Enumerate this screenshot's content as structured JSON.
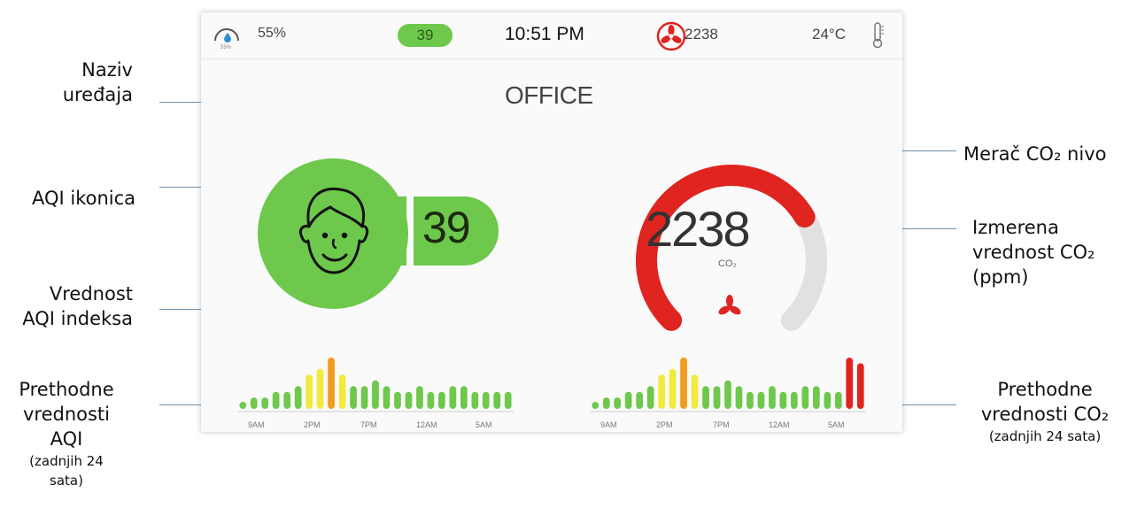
{
  "callouts": {
    "device_name": [
      "Naziv",
      "uređaja"
    ],
    "aqi_icon": "AQI ikonica",
    "aqi_value": [
      "Vrednost",
      "AQI indeksa"
    ],
    "aqi_history": [
      "Prethodne",
      "vrednosti",
      "AQI"
    ],
    "aqi_history_note": [
      "(zadnjih 24",
      "sata)"
    ],
    "co2_meter": "Merač CO₂ nivo",
    "co2_measured": [
      "Izmerena",
      "vrednost CO₂",
      "(ppm)"
    ],
    "co2_history": [
      "Prethodne",
      "vrednosti CO₂"
    ],
    "co2_history_note": "(zadnjih 24 sata)"
  },
  "status_bar": {
    "humidity": "55%",
    "gauge_caption": "55%",
    "aqi": "39",
    "time": "10:51 PM",
    "co2": "2238",
    "temperature": "24°C"
  },
  "device_name": "OFFICE",
  "aqi": {
    "value": "39",
    "level": 0.2
  },
  "co2": {
    "value": "2238",
    "unit": "CO₂",
    "gauge_fraction": 0.72
  },
  "history_ticks": [
    "9AM",
    "2PM",
    "7PM",
    "12AM",
    "5AM"
  ],
  "colors": {
    "green": "#6dc84b",
    "yellow": "#f2ea3c",
    "orange": "#f39a1f",
    "red": "#e0241f",
    "gray": "#e1e1e1"
  },
  "chart_data": [
    {
      "type": "bar",
      "title": "",
      "x_ticks": [
        "9AM",
        "2PM",
        "7PM",
        "12AM",
        "5AM"
      ],
      "values": [
        1,
        2,
        2,
        3,
        3,
        4,
        6,
        7,
        9,
        6,
        4,
        4,
        5,
        4,
        3,
        3,
        4,
        3,
        3,
        4,
        4,
        3,
        3,
        3,
        3
      ],
      "bar_colors": [
        "green",
        "green",
        "green",
        "green",
        "green",
        "green",
        "yellow",
        "yellow",
        "orange",
        "yellow",
        "green",
        "green",
        "green",
        "green",
        "green",
        "green",
        "green",
        "green",
        "green",
        "green",
        "green",
        "green",
        "green",
        "green",
        "green"
      ]
    },
    {
      "type": "bar",
      "title": "",
      "x_ticks": [
        "9AM",
        "2PM",
        "7PM",
        "12AM",
        "5AM"
      ],
      "values": [
        1,
        2,
        2,
        3,
        3,
        4,
        6,
        7,
        9,
        6,
        4,
        4,
        5,
        4,
        3,
        3,
        4,
        3,
        3,
        4,
        4,
        3,
        3,
        9,
        8
      ],
      "bar_colors": [
        "green",
        "green",
        "green",
        "green",
        "green",
        "green",
        "yellow",
        "yellow",
        "orange",
        "yellow",
        "green",
        "green",
        "green",
        "green",
        "green",
        "green",
        "green",
        "green",
        "green",
        "green",
        "green",
        "green",
        "green",
        "red",
        "red"
      ]
    }
  ]
}
